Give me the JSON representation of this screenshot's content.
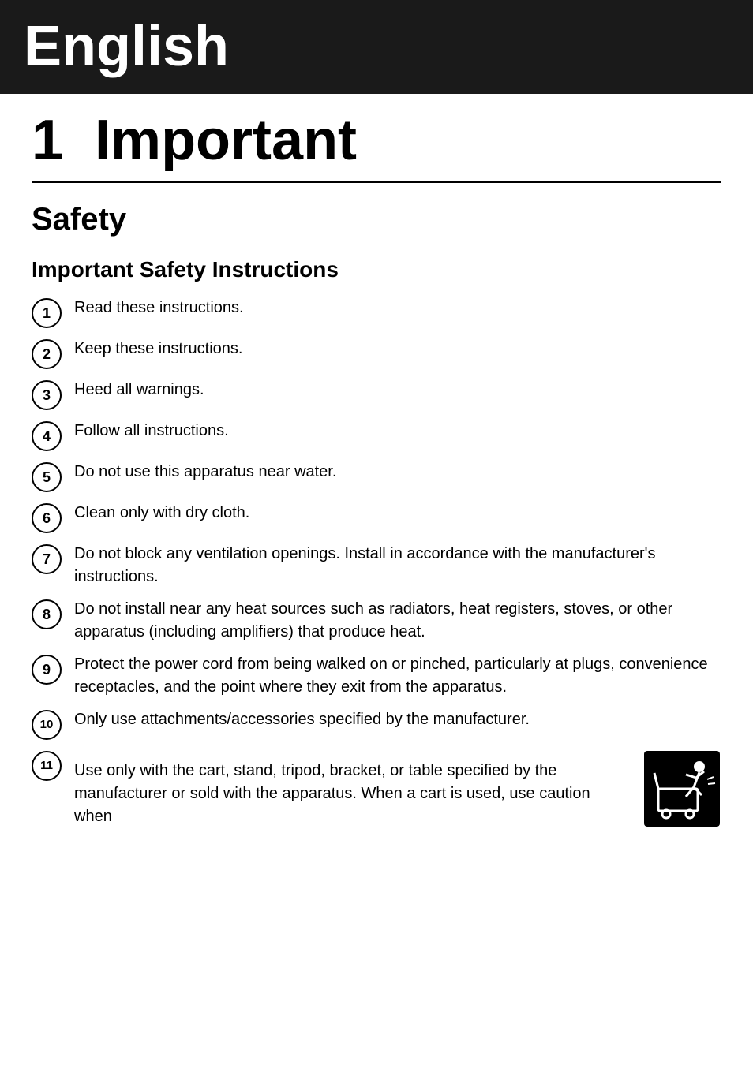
{
  "header": {
    "language": "English",
    "background_color": "#1a1a1a",
    "text_color": "#ffffff"
  },
  "chapter": {
    "number": "1",
    "title": "Important"
  },
  "section": {
    "title": "Safety"
  },
  "instructions": {
    "title": "Important Safety Instructions",
    "items": [
      {
        "number": "1",
        "text": "Read these instructions."
      },
      {
        "number": "2",
        "text": "Keep these instructions."
      },
      {
        "number": "3",
        "text": "Heed all warnings."
      },
      {
        "number": "4",
        "text": "Follow all instructions."
      },
      {
        "number": "5",
        "text": "Do not use this apparatus near water."
      },
      {
        "number": "6",
        "text": "Clean only with dry cloth."
      },
      {
        "number": "7",
        "text": "Do not block any ventilation openings. Install in accordance with the manufacturer's instructions."
      },
      {
        "number": "8",
        "text": "Do not install near any heat sources such as radiators, heat registers, stoves, or other apparatus (including amplifiers) that produce heat."
      },
      {
        "number": "9",
        "text": "Protect the power cord from being walked on or pinched, particularly at plugs, convenience receptacles, and the point where they exit from the apparatus."
      },
      {
        "number": "10",
        "text": "Only use attachments/accessories specified by the manufacturer."
      },
      {
        "number": "11",
        "text": "Use only with the cart, stand, tripod, bracket, or table specified by the manufacturer or sold with the apparatus. When a cart is used, use caution when"
      }
    ]
  }
}
